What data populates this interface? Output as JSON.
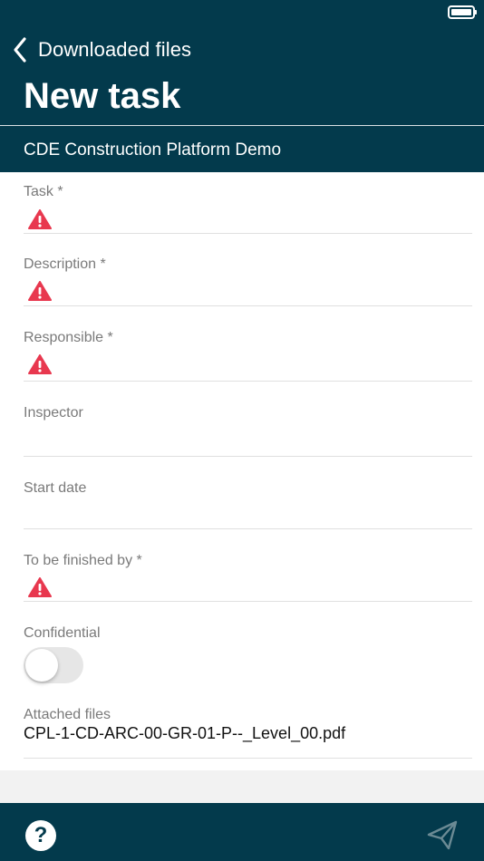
{
  "colors": {
    "header_bg": "#033a4c",
    "warning": "#e8384f",
    "label": "#7a7a7a"
  },
  "nav": {
    "back_label": "Downloaded files",
    "title": "New task",
    "project": "CDE Construction Platform Demo"
  },
  "form": {
    "fields": [
      {
        "label": "Task *",
        "warning_icon": "alert-triangle-icon"
      },
      {
        "label": "Description *",
        "warning_icon": "alert-triangle-icon"
      },
      {
        "label": "Responsible *",
        "warning_icon": "alert-triangle-icon"
      },
      {
        "label": "Inspector"
      },
      {
        "label": "Start date"
      },
      {
        "label": "To be finished by *",
        "warning_icon": "alert-triangle-icon"
      }
    ],
    "confidential": {
      "label": "Confidential",
      "value": false
    },
    "attachments": {
      "label": "Attached files",
      "files": [
        "CPL-1-CD-ARC-00-GR-01-P--_Level_00.pdf"
      ]
    }
  },
  "footer": {
    "help_icon": "question-circle-icon",
    "help_glyph": "?",
    "send_icon": "paper-plane-icon"
  }
}
